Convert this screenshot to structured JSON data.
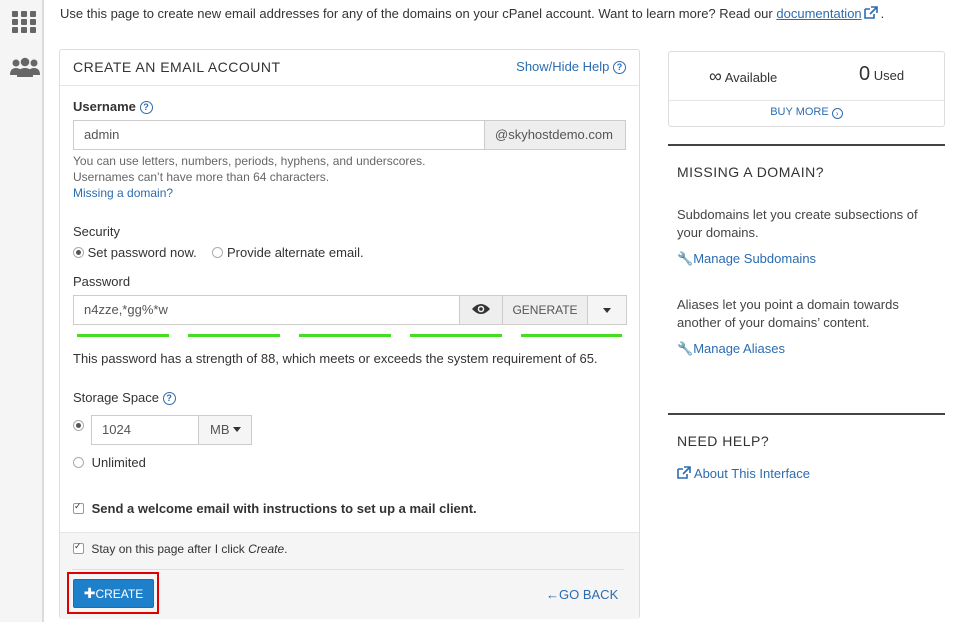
{
  "intro": {
    "text": "Use this page to create new email addresses for any of the domains on your cPanel account. Want to learn more? Read our",
    "link": "documentation",
    "suffix": "."
  },
  "form": {
    "title": "CREATE AN EMAIL ACCOUNT",
    "show_hide_help": "Show/Hide Help",
    "username_label": "Username",
    "username_value": "admin",
    "domain": "@skyhostdemo.com",
    "username_help_1": "You can use letters, numbers, periods, hyphens, and underscores.",
    "username_help_2": "Usernames can’t have more than 64 characters.",
    "missing_domain_link": "Missing a domain?",
    "security_label": "Security",
    "security_option_1": "Set password now.",
    "security_option_2": "Provide alternate email.",
    "password_label": "Password",
    "password_value": "n4zze,*gg%*w",
    "generate_label": "GENERATE",
    "strength_percent": 88,
    "strength_text": "This password has a strength of 88, which meets or exceeds the system requirement of 65.",
    "storage_label": "Storage Space",
    "storage_value": "1024",
    "storage_unit": "MB",
    "unlimited_label": "Unlimited",
    "welcome_email_label": "Send a welcome email with instructions to set up a mail client.",
    "stay_on_page_prefix": "Stay on this page after I click",
    "stay_on_page_em": "Create",
    "stay_on_page_suffix": ".",
    "create_label": "CREATE",
    "go_back_label": "GO BACK"
  },
  "stats": {
    "available_value": "∞",
    "available_label": "Available",
    "used_value": "0",
    "used_label": "Used",
    "buy_more": "BUY MORE"
  },
  "sidebar": {
    "missing_domain_title": "MISSING A DOMAIN?",
    "subdomains_text": "Subdomains let you create subsections of your domains.",
    "manage_subdomains": "Manage Subdomains",
    "aliases_text": "Aliases let you point a domain towards another of your domains’ content.",
    "manage_aliases": "Manage Aliases",
    "need_help_title": "NEED HELP?",
    "about_interface": "About This Interface"
  },
  "colors": {
    "accent": "#2b6cb0",
    "primary_button": "#1e7fcb",
    "strength_bar": "#44dd22",
    "highlight": "#e00000"
  }
}
